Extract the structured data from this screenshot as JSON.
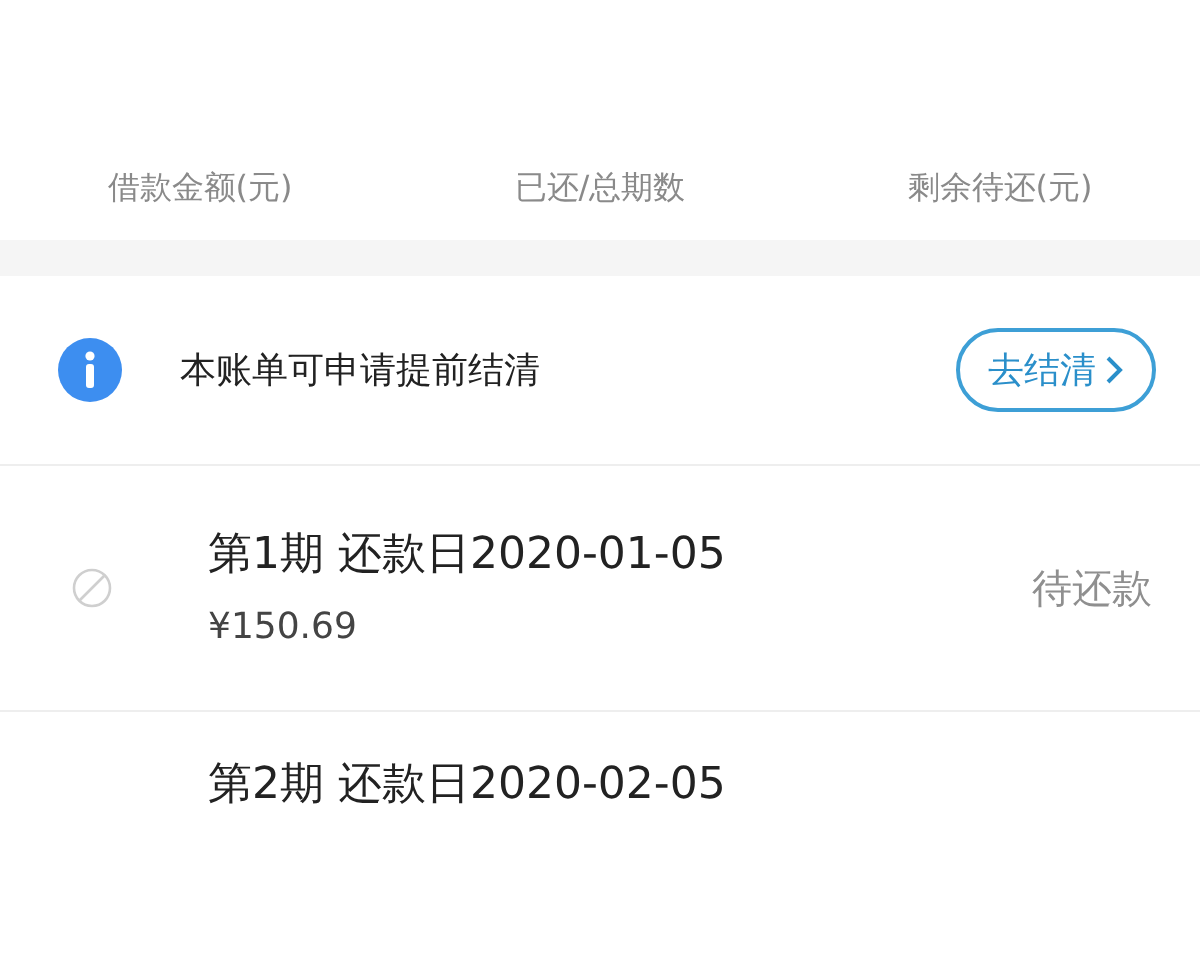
{
  "summary_labels": [
    "借款金额(元)",
    "已还/总期数",
    "剩余待还(元)"
  ],
  "notice": {
    "text": "本账单可申请提前结清",
    "button": "去结清"
  },
  "installments": [
    {
      "title": "第1期 还款日2020-01-05",
      "amount": "¥150.69",
      "status": "待还款"
    },
    {
      "title": "第2期 还款日2020-02-05"
    }
  ]
}
